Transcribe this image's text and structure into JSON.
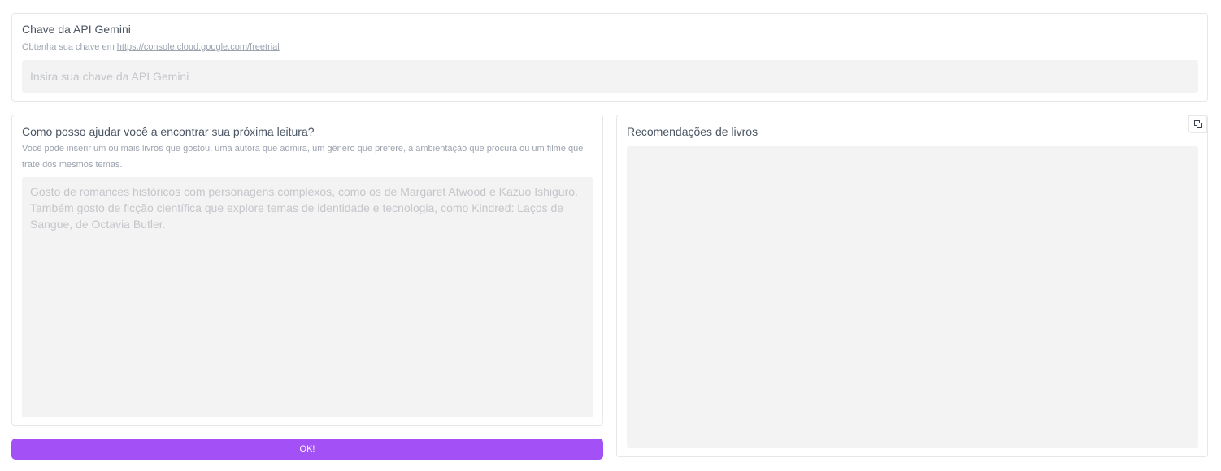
{
  "api_key": {
    "label": "Chave da API Gemini",
    "info_prefix": "Obtenha sua chave em ",
    "info_link": "https://console.cloud.google.com/freetrial",
    "placeholder": "Insira sua chave da API Gemini",
    "value": ""
  },
  "question": {
    "label": "Como posso ajudar você a encontrar sua próxima leitura?",
    "info": "Você pode inserir um ou mais livros que gostou, uma autora que admira, um gênero que prefere, a ambientação que procura ou um filme que trate dos mesmos temas.",
    "placeholder": "Gosto de romances históricos com personagens complexos, como os de Margaret Atwood e Kazuo Ishiguro. Também gosto de ficção científica que explore temas de identidade e tecnologia, como Kindred: Laços de Sangue, de Octavia Butler.",
    "value": ""
  },
  "submit": {
    "label": "OK!",
    "color": "#a351f7"
  },
  "output": {
    "label": "Recomendações de livros",
    "value": "",
    "copy_icon": "copy-icon"
  }
}
